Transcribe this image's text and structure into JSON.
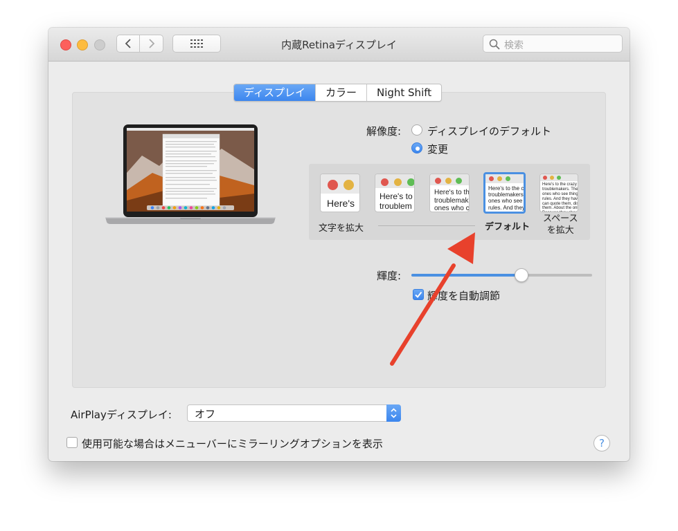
{
  "window": {
    "title": "内蔵Retinaディスプレイ",
    "search_placeholder": "検索"
  },
  "tabs": [
    {
      "label": "ディスプレイ",
      "active": true
    },
    {
      "label": "カラー",
      "active": false
    },
    {
      "label": "Night Shift",
      "active": false
    }
  ],
  "resolution": {
    "label": "解像度:",
    "options": [
      {
        "label": "ディスプレイのデフォルト",
        "selected": false
      },
      {
        "label": "変更",
        "selected": true
      }
    ]
  },
  "scaling": {
    "thumbs": [
      {
        "text": "Here's",
        "selected": false
      },
      {
        "text": "Here's to\ntroublem",
        "selected": false
      },
      {
        "text": "Here's to th\ntroublemak\nones who c",
        "selected": false
      },
      {
        "text": "Here's to the cr\ntroublemakers.\nones who see t\nrules. And they",
        "selected": true
      },
      {
        "text": "Here's to the crazy one\ntroublemakers. The rou\nones who see things di\nrules. And they have no\ncan quote them, disagr\nthem. About the only th\nBecause they change t",
        "selected": false
      }
    ],
    "label_left": "文字を拡大",
    "label_default": "デフォルト",
    "label_right": "スペース\nを拡大"
  },
  "brightness": {
    "label": "輝度:",
    "value": 0.61,
    "auto_label": "輝度を自動調節",
    "auto_checked": true
  },
  "airplay": {
    "label": "AirPlayディスプレイ:",
    "value": "オフ"
  },
  "mirror": {
    "label": "使用可能な場合はメニューバーにミラーリングオプションを表示",
    "checked": false
  },
  "help_label": "?",
  "colors": {
    "accent": "#3c86ee",
    "annotation_arrow": "#e8412c"
  }
}
